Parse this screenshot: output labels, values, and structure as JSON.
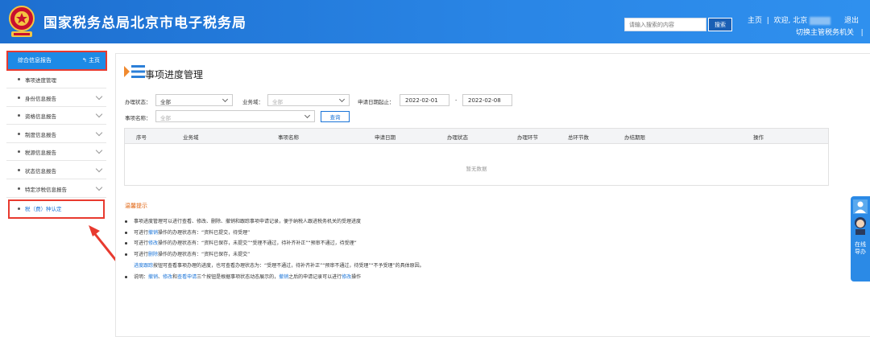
{
  "header": {
    "title": "国家税务总局北京市电子税务局",
    "search_placeholder": "请输入搜索的内容",
    "search_button": "搜索",
    "home_link": "主页",
    "welcome_text": "欢迎, 北京",
    "switch_authority": "切换主管税务机关",
    "logout": "退出"
  },
  "sidebar": {
    "head_label": "综合信息报告",
    "home_label": "主页",
    "items": [
      {
        "label": "事项进度管理",
        "has_chevron": false
      },
      {
        "label": "身份信息报告",
        "has_chevron": true
      },
      {
        "label": "资格信息报告",
        "has_chevron": true
      },
      {
        "label": "制度信息报告",
        "has_chevron": true
      },
      {
        "label": "税源信息报告",
        "has_chevron": true
      },
      {
        "label": "状态信息报告",
        "has_chevron": true
      },
      {
        "label": "特定涉税信息报告",
        "has_chevron": true
      },
      {
        "label": "税（费）种认定",
        "has_chevron": false
      }
    ]
  },
  "main": {
    "title": "事项进度管理",
    "filters": {
      "status_label": "办理状态：",
      "status_value": "全部",
      "business_label": "业务域：",
      "business_value": "全部",
      "date_label": "申请日期起止：",
      "date_from": "2022-02-01",
      "date_sep": "-",
      "date_to": "2022-02-08",
      "name_label": "事项名称：",
      "name_value": "全部",
      "query_button": "查询"
    },
    "table": {
      "columns": [
        "序号",
        "业务域",
        "事项名称",
        "申请日期",
        "办理状态",
        "办理环节",
        "总环节数",
        "办结期限",
        "操作"
      ],
      "empty_text": "暂无数据"
    },
    "tips": {
      "title": "温馨提示",
      "lines": [
        {
          "parts": [
            {
              "t": "事项进度管理可以进行查看、修改、删除、撤销和跟踪事项申请记录，便于纳税人跟进税务机关的受理进度"
            }
          ]
        },
        {
          "parts": [
            {
              "t": "可进行"
            },
            {
              "t": "撤销",
              "link": true
            },
            {
              "t": "操作的办理状态有：“资料已提交，待受理”"
            }
          ]
        },
        {
          "parts": [
            {
              "t": "可进行"
            },
            {
              "t": "修改",
              "link": true
            },
            {
              "t": "操作的办理状态有：“资料已保存，未提交”“受理不通过，待补齐补正”“预审不通过，待受理”"
            }
          ]
        },
        {
          "parts": [
            {
              "t": "可进行"
            },
            {
              "t": "删除",
              "link": true
            },
            {
              "t": "操作的办理状态有：“资料已保存，未提交”"
            }
          ]
        },
        {
          "parts": [
            {
              "t": "进度跟踪",
              "link": true
            },
            {
              "t": "按钮可查看事项办理的进度，也可查看办理状态为：“受理不通过，待补齐补正”“预审不通过，待受理”“不予受理”的具体原因。"
            }
          ],
          "indent": true
        },
        {
          "parts": [
            {
              "t": "说明："
            },
            {
              "t": "撤销",
              "link": true
            },
            {
              "t": "、"
            },
            {
              "t": "修改",
              "link": true
            },
            {
              "t": "和"
            },
            {
              "t": "查看申请",
              "link": true
            },
            {
              "t": "三个按钮是根据事项状态动态展示的，"
            },
            {
              "t": "撤销",
              "link": true
            },
            {
              "t": "之后的申请记录可以进行"
            },
            {
              "t": "修改",
              "link": true
            },
            {
              "t": "操作"
            }
          ]
        }
      ]
    }
  },
  "side_widget": {
    "label": "在线导办"
  },
  "colors": {
    "header_blue": "#2a86e6",
    "accent_blue": "#1a74d8",
    "highlight_red": "#e83a2f",
    "tips_orange": "#e0620d"
  }
}
